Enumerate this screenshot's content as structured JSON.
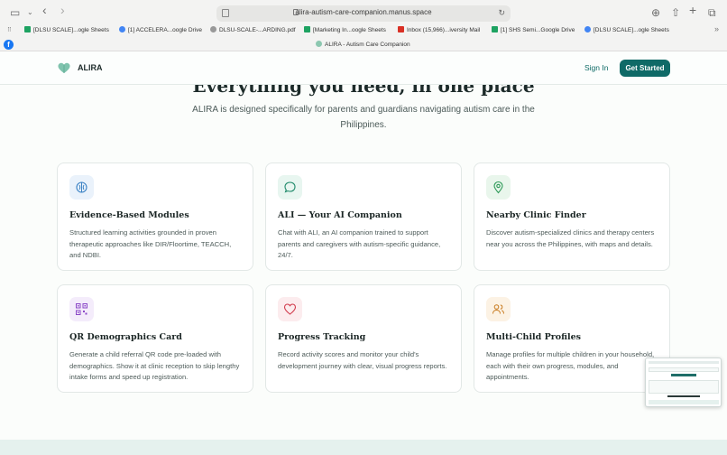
{
  "browser": {
    "url": "alira-autism-care-companion.manus.space",
    "bookmarks": [
      {
        "label": "[DLSU SCALE]...ogle Sheets",
        "color": "#1ea362"
      },
      {
        "label": "[1] ACCELERA...oogle Drive",
        "color": "#4285f4"
      },
      {
        "label": "DLSU-SCALE-...ARDING.pdf",
        "color": "#888888"
      },
      {
        "label": "[Marketing In...oogle Sheets",
        "color": "#1ea362"
      },
      {
        "label": "Inbox (15,966)...iversity Mail",
        "color": "#d93025"
      },
      {
        "label": "[1] SHS Semi...Google Drive",
        "color": "#1ea362"
      },
      {
        "label": "[DLSU SCALE]...ogle Sheets",
        "color": "#4285f4"
      }
    ],
    "active_tab": "ALIRA - Autism Care Companion"
  },
  "header": {
    "brand": "ALIRA",
    "signin": "Sign In",
    "cta": "Get Started"
  },
  "hero": {
    "headline": "Everything you need, in one place",
    "subtitle": "ALIRA is designed specifically for parents and guardians navigating autism care in the Philippines."
  },
  "features": [
    {
      "icon": "brain-icon",
      "accent": "#3b82c4",
      "bg": "#eaf2fb",
      "title": "Evidence-Based Modules",
      "desc": "Structured learning activities grounded in proven therapeutic approaches like DIR/Floortime, TEACCH, and NDBI."
    },
    {
      "icon": "chat-bubble-icon",
      "accent": "#1f8a6a",
      "bg": "#e8f6f0",
      "title": "ALI — Your AI Companion",
      "desc": "Chat with ALI, an AI companion trained to support parents and caregivers with autism-specific guidance, 24/7."
    },
    {
      "icon": "map-pin-icon",
      "accent": "#2e9a58",
      "bg": "#e9f6ec",
      "title": "Nearby Clinic Finder",
      "desc": "Discover autism-specialized clinics and therapy centers near you across the Philippines, with maps and details."
    },
    {
      "icon": "qr-code-icon",
      "accent": "#8a46c7",
      "bg": "#f4ecfb",
      "title": "QR Demographics Card",
      "desc": "Generate a child referral QR code pre-loaded with demographics. Show it at clinic reception to skip lengthy intake forms and speed up registration."
    },
    {
      "icon": "heart-icon",
      "accent": "#d0384a",
      "bg": "#fcecee",
      "title": "Progress Tracking",
      "desc": "Record activity scores and monitor your child's development journey with clear, visual progress reports."
    },
    {
      "icon": "users-icon",
      "accent": "#c87a1e",
      "bg": "#fcf2e4",
      "title": "Multi-Child Profiles",
      "desc": "Manage profiles for multiple children in your household, each with their own progress, modules, and appointments."
    }
  ]
}
